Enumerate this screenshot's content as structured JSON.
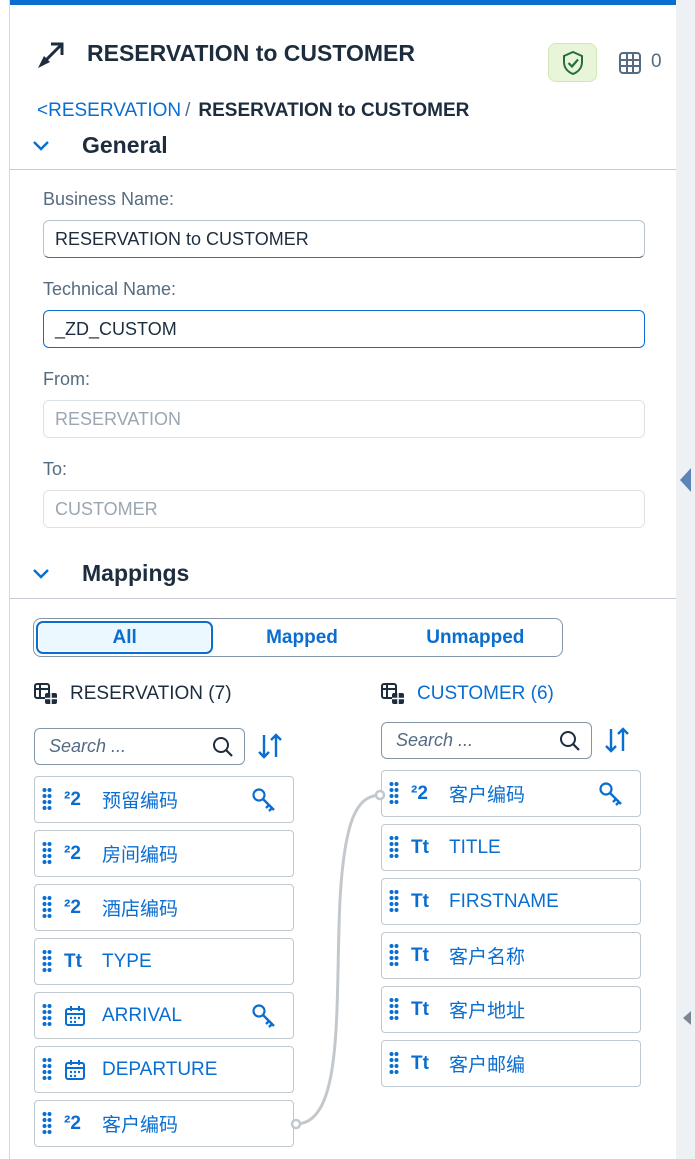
{
  "header": {
    "title": "RESERVATION to CUSTOMER",
    "grid_count": "0"
  },
  "breadcrumb": {
    "parent": "<RESERVATION",
    "separator": "/",
    "current": "RESERVATION to CUSTOMER"
  },
  "general": {
    "title": "General",
    "business_name_label": "Business Name:",
    "business_name_value": "RESERVATION to CUSTOMER",
    "technical_name_label": "Technical Name:",
    "technical_name_value": "_ZD_CUSTOM",
    "from_label": "From:",
    "from_value": "RESERVATION",
    "to_label": "To:",
    "to_value": "CUSTOMER"
  },
  "mappings": {
    "title": "Mappings",
    "filters": [
      "All",
      "Mapped",
      "Unmapped"
    ],
    "active_filter": "All",
    "source": {
      "name": "RESERVATION (7)",
      "search_placeholder": "Search ...",
      "columns": [
        {
          "label": "预留编码",
          "type": "integer-icon",
          "key": true
        },
        {
          "label": "房间编码",
          "type": "integer-icon",
          "key": false
        },
        {
          "label": "酒店编码",
          "type": "integer-icon",
          "key": false
        },
        {
          "label": "TYPE",
          "type": "text-icon",
          "key": false
        },
        {
          "label": "ARRIVAL",
          "type": "calendar-icon",
          "key": true
        },
        {
          "label": "DEPARTURE",
          "type": "calendar-icon",
          "key": false
        },
        {
          "label": "客户编码",
          "type": "integer-icon",
          "key": false
        }
      ]
    },
    "target": {
      "name": "CUSTOMER (6)",
      "search_placeholder": "Search ...",
      "columns": [
        {
          "label": "客户编码",
          "type": "integer-icon",
          "key": true
        },
        {
          "label": "TITLE",
          "type": "text-icon",
          "key": false
        },
        {
          "label": "FIRSTNAME",
          "type": "text-icon",
          "key": false
        },
        {
          "label": "客户名称",
          "type": "text-icon",
          "key": false
        },
        {
          "label": "客户地址",
          "type": "text-icon",
          "key": false
        },
        {
          "label": "客户邮编",
          "type": "text-icon",
          "key": false
        }
      ]
    },
    "integer_icon_text": "²2",
    "text_icon_text": "Tt"
  },
  "colors": {
    "accent": "#0a6ed1",
    "success_bg": "#e8f5d9",
    "success": "#256f3a"
  }
}
